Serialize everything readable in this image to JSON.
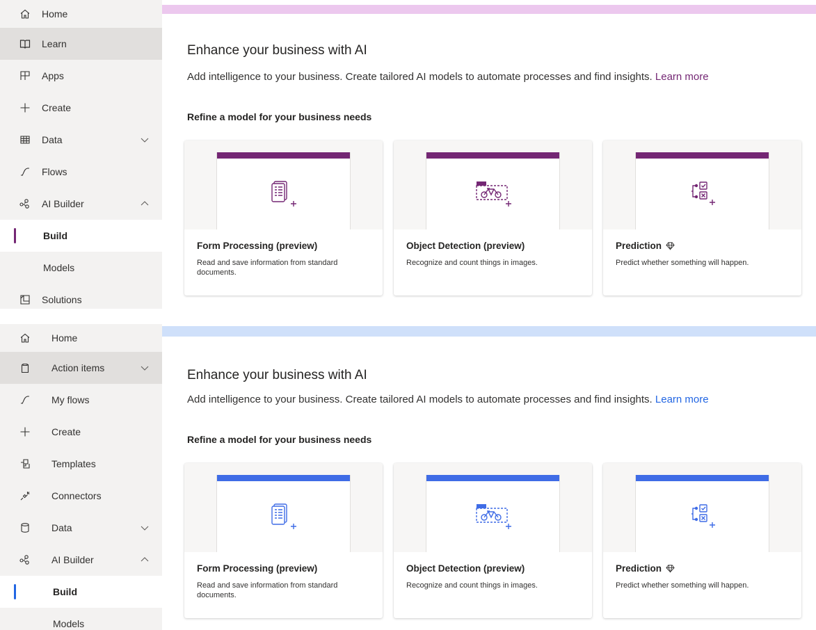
{
  "panel1": {
    "accent": "#742774",
    "topbar_color": "#ecc8ee",
    "link_color": "#742774",
    "sidebar": {
      "items": [
        {
          "label": "Home",
          "icon": "home-icon"
        },
        {
          "label": "Learn",
          "icon": "book-icon"
        },
        {
          "label": "Apps",
          "icon": "apps-icon"
        },
        {
          "label": "Create",
          "icon": "plus-icon"
        },
        {
          "label": "Data",
          "icon": "table-icon"
        },
        {
          "label": "Flows",
          "icon": "flow-icon"
        },
        {
          "label": "AI Builder",
          "icon": "ai-builder-icon"
        },
        {
          "label": "Build"
        },
        {
          "label": "Models"
        },
        {
          "label": "Solutions",
          "icon": "solutions-icon"
        }
      ]
    },
    "heading": "Enhance your business with AI",
    "description": "Add intelligence to your business. Create tailored AI models to automate processes and find insights.",
    "learn_more": "Learn more",
    "section_title": "Refine a model for your business needs",
    "cards": [
      {
        "title": "Form Processing (preview)",
        "text": "Read and save information from standard documents.",
        "icon": "form-processing-icon"
      },
      {
        "title": "Object Detection (preview)",
        "text": "Recognize and count things in images.",
        "icon": "object-detection-icon"
      },
      {
        "title": "Prediction",
        "text": "Predict whether something will happen.",
        "icon": "prediction-icon",
        "badge_icon": "premium-diamond-icon"
      }
    ]
  },
  "panel2": {
    "accent": "#3f6ce6",
    "topbar_color": "#cfe0fa",
    "link_color": "#2266e3",
    "sidebar": {
      "items": [
        {
          "label": "Home",
          "icon": "home-icon"
        },
        {
          "label": "Action items",
          "icon": "clipboard-icon"
        },
        {
          "label": "My flows",
          "icon": "flow-icon"
        },
        {
          "label": "Create",
          "icon": "plus-icon"
        },
        {
          "label": "Templates",
          "icon": "templates-icon"
        },
        {
          "label": "Connectors",
          "icon": "connectors-icon"
        },
        {
          "label": "Data",
          "icon": "database-icon"
        },
        {
          "label": "AI Builder",
          "icon": "ai-builder-icon"
        },
        {
          "label": "Build"
        },
        {
          "label": "Models"
        }
      ]
    },
    "heading": "Enhance your business with AI",
    "description": "Add intelligence to your business. Create tailored AI models to automate processes and find insights.",
    "learn_more": "Learn more",
    "section_title": "Refine a model for your business needs",
    "cards": [
      {
        "title": "Form Processing (preview)",
        "text": "Read and save information from standard documents.",
        "icon": "form-processing-icon"
      },
      {
        "title": "Object Detection (preview)",
        "text": "Recognize and count things in images.",
        "icon": "object-detection-icon"
      },
      {
        "title": "Prediction",
        "text": "Predict whether something will happen.",
        "icon": "prediction-icon",
        "badge_icon": "premium-diamond-icon"
      }
    ]
  }
}
